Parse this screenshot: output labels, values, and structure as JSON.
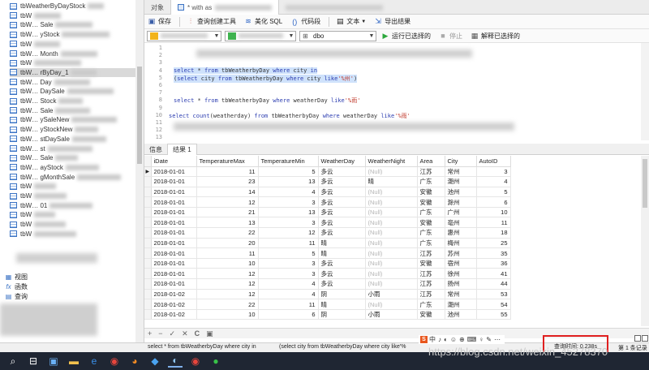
{
  "left_tree": {
    "tables": [
      {
        "label": "tbWeatherByDayStock"
      },
      {
        "label": "tbW"
      },
      {
        "label": "tbW… Sale"
      },
      {
        "label": "tbW… yStock"
      },
      {
        "label": "tbW"
      },
      {
        "label": "tbW… Month"
      },
      {
        "label": "tbW"
      },
      {
        "label": "tbW… rByDay_1"
      },
      {
        "label": "tbW… Day"
      },
      {
        "label": "tbW… DaySale"
      },
      {
        "label": "tbW… Stock"
      },
      {
        "label": "tbW… Sale"
      },
      {
        "label": "tbW… ySaleNew"
      },
      {
        "label": "tbW… yStockNew"
      },
      {
        "label": "tbW… stDaySale"
      },
      {
        "label": "tbW… st"
      },
      {
        "label": "tbW… Sale"
      },
      {
        "label": "tbW… ayStock"
      },
      {
        "label": "tbW… gMonthSale"
      },
      {
        "label": "tbW"
      },
      {
        "label": "tbW"
      },
      {
        "label": "tbW… 01"
      },
      {
        "label": "tbW"
      },
      {
        "label": "tbW"
      },
      {
        "label": "tbW"
      }
    ],
    "selected_index": 7,
    "views_label": "视图",
    "functions_label": "函数",
    "queries_label": "查询"
  },
  "tabs": {
    "objects_label": "对象",
    "query_tab_label": "* with as"
  },
  "toolbar": {
    "save": "保存",
    "query_builder": "查询创建工具",
    "beautify": "美化 SQL",
    "snippet": "代码段",
    "text": "文本",
    "export": "导出结果"
  },
  "toolbar2": {
    "schema": "dbo",
    "run_selected": "运行已选择的",
    "stop": "停止",
    "explain": "解释已选择的"
  },
  "editor": {
    "lines": [
      {
        "n": "1",
        "text": ""
      },
      {
        "n": "2",
        "text": ""
      },
      {
        "n": "3",
        "text": ""
      },
      {
        "n": "4",
        "text": "select * from tbWeatherbyDay where city in"
      },
      {
        "n": "5",
        "text": "(select city from tbWeatherbyDay where city like'%州')"
      },
      {
        "n": "6",
        "text": ""
      },
      {
        "n": "7",
        "text": ""
      },
      {
        "n": "8",
        "text": "select * from tbWeatherbyDay where weatherDay like'%雨'"
      },
      {
        "n": "9",
        "text": ""
      },
      {
        "n": "10",
        "text": "select count(weatherday) from tbWeatherbyDay where weatherDay like'%雨'"
      },
      {
        "n": "11",
        "text": ""
      },
      {
        "n": "12",
        "text": ""
      },
      {
        "n": "13",
        "text": ""
      }
    ]
  },
  "result_tabs": [
    "信息",
    "结果 1"
  ],
  "grid": {
    "columns": [
      "iDate",
      "TemperatureMax",
      "TemperatureMin",
      "WeatherDay",
      "WeatherNight",
      "Area",
      "City",
      "AutoID"
    ],
    "rows": [
      [
        "2018-01-01",
        "11",
        "5",
        "多云",
        "(Null)",
        "江苏",
        "常州",
        "3"
      ],
      [
        "2018-01-01",
        "23",
        "13",
        "多云",
        "晴",
        "广东",
        "潮州",
        "4"
      ],
      [
        "2018-01-01",
        "14",
        "4",
        "多云",
        "(Null)",
        "安徽",
        "池州",
        "5"
      ],
      [
        "2018-01-01",
        "12",
        "3",
        "多云",
        "(Null)",
        "安徽",
        "滁州",
        "6"
      ],
      [
        "2018-01-01",
        "21",
        "13",
        "多云",
        "(Null)",
        "广东",
        "广州",
        "10"
      ],
      [
        "2018-01-01",
        "13",
        "3",
        "多云",
        "(Null)",
        "安徽",
        "亳州",
        "11"
      ],
      [
        "2018-01-01",
        "22",
        "12",
        "多云",
        "(Null)",
        "广东",
        "惠州",
        "18"
      ],
      [
        "2018-01-01",
        "20",
        "11",
        "晴",
        "(Null)",
        "广东",
        "梅州",
        "25"
      ],
      [
        "2018-01-01",
        "11",
        "5",
        "晴",
        "(Null)",
        "江苏",
        "苏州",
        "35"
      ],
      [
        "2018-01-01",
        "10",
        "3",
        "多云",
        "(Null)",
        "安徽",
        "宿州",
        "36"
      ],
      [
        "2018-01-01",
        "12",
        "3",
        "多云",
        "(Null)",
        "江苏",
        "徐州",
        "41"
      ],
      [
        "2018-01-01",
        "12",
        "4",
        "多云",
        "(Null)",
        "江苏",
        "扬州",
        "44"
      ],
      [
        "2018-01-02",
        "12",
        "4",
        "阴",
        "小雨",
        "江苏",
        "常州",
        "53"
      ],
      [
        "2018-01-02",
        "22",
        "11",
        "晴",
        "(Null)",
        "广东",
        "潮州",
        "54"
      ],
      [
        "2018-01-02",
        "10",
        "6",
        "阴",
        "小雨",
        "安徽",
        "池州",
        "55"
      ]
    ]
  },
  "grid_footer": [
    "+",
    "−",
    "✓",
    "✕",
    "C",
    "▣"
  ],
  "status": {
    "sql_part1": "select * from tbWeatherbyDay where city in",
    "sql_part2": "(select city from tbWeatherbyDay where city like'%",
    "query_time": "查询时间: 0.238s",
    "record_info": "第 1 条记录",
    "ime_items": [
      "中",
      "♪",
      "◐",
      "☺",
      "⊕",
      "⌨",
      "♀",
      "✎",
      "⋯"
    ]
  },
  "watermark": "https://blog.csdn.net/weixin_45278370",
  "taskbar_icons": [
    "windows-search-icon",
    "task-view-icon",
    "app-icon",
    "explorer-icon",
    "edge-icon",
    "chrome-icon",
    "firefox-icon",
    "pinned-app-icon",
    "navicat-icon",
    "chrome-icon-2",
    "wechat-icon"
  ]
}
